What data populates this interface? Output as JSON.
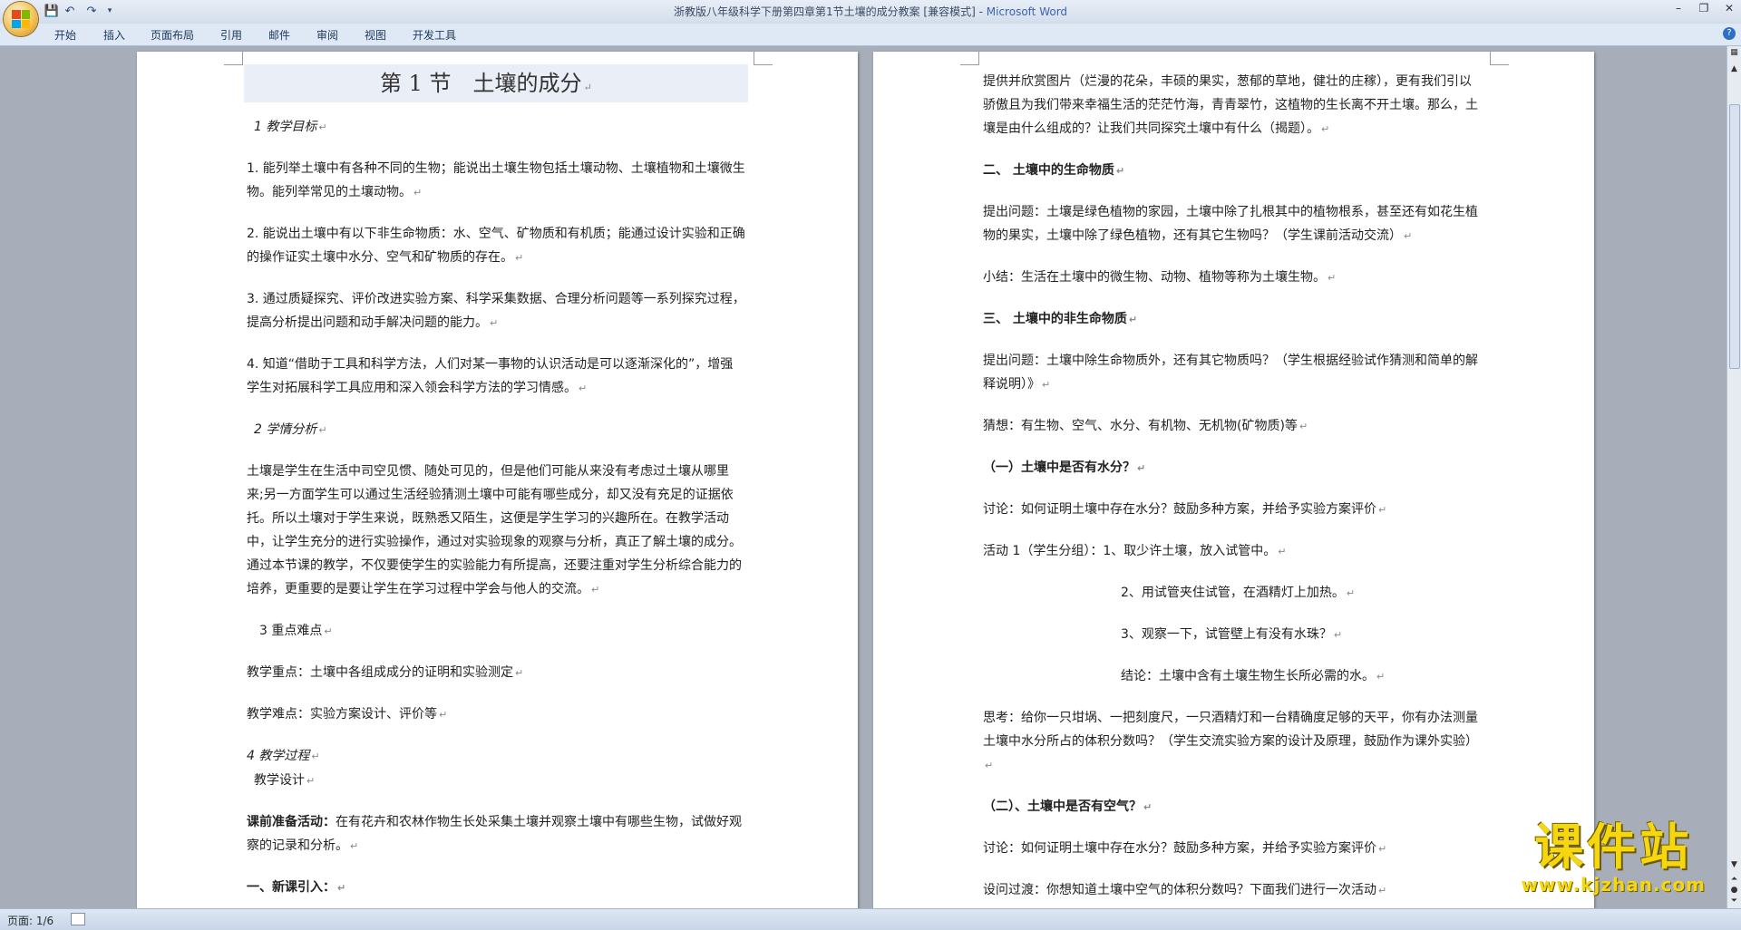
{
  "window": {
    "title": "浙教版八年级科学下册第四章第1节土壤的成分教案 [兼容模式]",
    "app_name": "Microsoft Word"
  },
  "ribbon": {
    "tabs": [
      "开始",
      "插入",
      "页面布局",
      "引用",
      "邮件",
      "审阅",
      "视图",
      "开发工具"
    ]
  },
  "page1": {
    "title": "第 1 节　土壤的成分",
    "sec1": "1 教学目标",
    "g1": "1. 能列举土壤中有各种不同的生物；能说出土壤生物包括土壤动物、土壤植物和土壤微生物。能列举常见的土壤动物。",
    "g2": "2. 能说出土壤中有以下非生命物质：水、空气、矿物质和有机质；能通过设计实验和正确的操作证实土壤中水分、空气和矿物质的存在。",
    "g3": "3. 通过质疑探究、评价改进实验方案、科学采集数据、合理分析问题等一系列探究过程，提高分析提出问题和动手解决问题的能力。",
    "g4": "4. 知道“借助于工具和科学方法，人们对某一事物的认识活动是可以逐渐深化的”，增强学生对拓展科学工具应用和深入领会科学方法的学习情感。",
    "sec2": "2 学情分析",
    "analysis": "土壤是学生在生活中司空见惯、随处可见的，但是他们可能从来没有考虑过土壤从哪里来;另一方面学生可以通过生活经验猜测土壤中可能有哪些成分，却又没有充足的证据依托。所以土壤对于学生来说，既熟悉又陌生，这便是学生学习的兴趣所在。在教学活动中，让学生充分的进行实验操作，通过对实验现象的观察与分析，真正了解土壤的成分。通过本节课的教学，不仅要使学生的实验能力有所提高，还要注重对学生分析综合能力的培养，更重要的是要让学生在学习过程中学会与他人的交流。",
    "sec3": "3 重点难点",
    "key": "教学重点：土壤中各组成成分的证明和实验测定",
    "difficult": "教学难点：实验方案设计、评价等",
    "sec4": "4 教学过程",
    "design": "教学设计",
    "prep_label": "课前准备活动：",
    "prep_text": "在有花卉和农林作物生长处采集土壤并观察土壤中有哪些生物，试做好观察的记录和分析。",
    "intro": "一、新课引入："
  },
  "page2": {
    "p_intro": "提供并欣赏图片（烂漫的花朵，丰硕的果实，葱郁的草地，健壮的庄稼），更有我们引以骄傲且为我们带来幸福生活的茫茫竹海，青青翠竹，这植物的生长离不开土壤。那么，土壤是由什么组成的？让我们共同探究土壤中有什么（揭题）。",
    "h2": "二、 土壤中的生命物质",
    "q1": "提出问题：土壤是绿色植物的家园，土壤中除了扎根其中的植物根系，甚至还有如花生植物的果实，土壤中除了绿色植物，还有其它生物吗？（学生课前活动交流）",
    "summary": "小结：生活在土壤中的微生物、动物、植物等称为土壤生物。",
    "h3": "三、 土壤中的非生命物质",
    "q2": "提出问题：土壤中除生命物质外，还有其它物质吗？（学生根据经验试作猜测和简单的解释说明）》",
    "guess": "猜想：有生物、空气、水分、有机物、无机物(矿物质)等",
    "sub1": "（一）土壤中是否有水分？",
    "discuss1": "讨论：如何证明土壤中存在水分？鼓励多种方案，并给予实验方案评价",
    "act1": "活动 1（学生分组）：1、取少许土壤，放入试管中。",
    "act2": "2、用试管夹住试管，在酒精灯上加热。",
    "act3": "3、观察一下，试管壁上有没有水珠？",
    "concl": "结论：土壤中含有土壤生物生长所必需的水。",
    "think": "思考：给你一只坩埚、一把刻度尺，一只酒精灯和一台精确度足够的天平，你有办法测量土壤中水分所占的体积分数吗？（学生交流实验方案的设计及原理，鼓励作为课外实验）",
    "sub2": "（二）、土壤中是否有空气？",
    "discuss2": "讨论：如何证明土壤中存在水分？鼓励多种方案，并给予实验方案评价",
    "transition": "设问过渡：你想知道土壤中空气的体积分数吗？下面我们进行一次活动"
  },
  "status": {
    "page_count": "页面: 1/6"
  },
  "watermark": {
    "cn": "课件站",
    "url": "www.kjzhan.com"
  }
}
